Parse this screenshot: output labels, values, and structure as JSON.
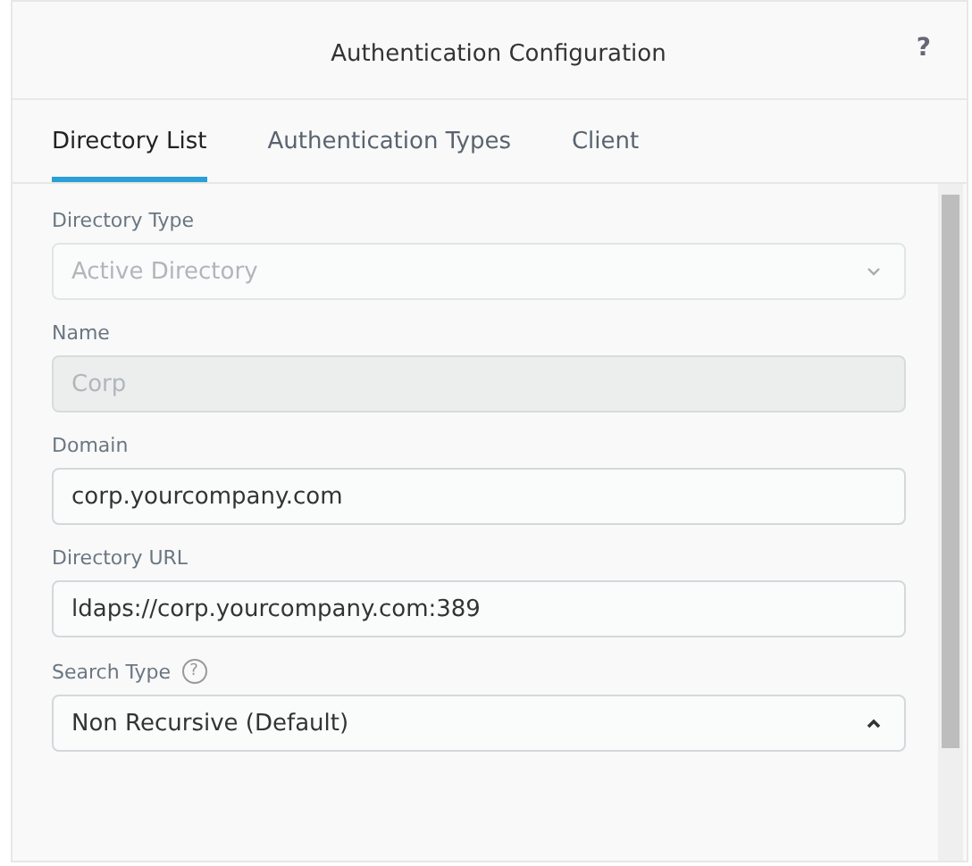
{
  "dialog": {
    "title": "Authentication Configuration",
    "help": "?"
  },
  "tabs": [
    {
      "label": "Directory List",
      "selected": true
    },
    {
      "label": "Authentication Types",
      "selected": false
    },
    {
      "label": "Client",
      "selected": false
    }
  ],
  "fields": [
    {
      "kind": "select",
      "label": "Directory Type",
      "value": "Active Directory",
      "disabled": true,
      "expanded": false
    },
    {
      "kind": "text",
      "label": "Name",
      "value": "Corp",
      "disabled": true
    },
    {
      "kind": "text",
      "label": "Domain",
      "value": "corp.yourcompany.com",
      "disabled": false
    },
    {
      "kind": "text",
      "label": "Directory URL",
      "value": "ldaps://corp.yourcompany.com:389",
      "disabled": false
    },
    {
      "kind": "select",
      "label": "Search Type",
      "value": "Non Recursive (Default)",
      "disabled": false,
      "expanded": true,
      "help": "?"
    }
  ]
}
